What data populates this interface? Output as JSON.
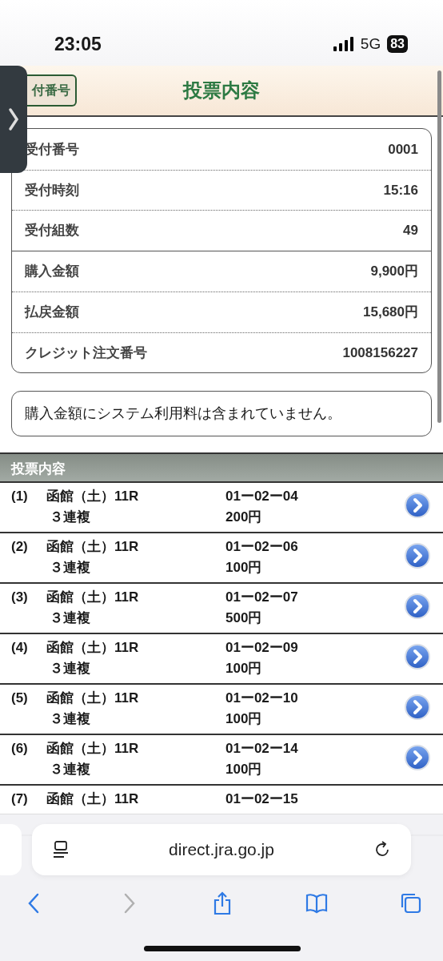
{
  "status_bar": {
    "time": "23:05",
    "network": "5G",
    "battery": "83"
  },
  "header": {
    "back_button": "付番号",
    "title": "投票内容"
  },
  "summary": {
    "groups": [
      [
        {
          "label": "受付番号",
          "value": "0001"
        },
        {
          "label": "受付時刻",
          "value": "15:16"
        },
        {
          "label": "受付組数",
          "value": "49"
        }
      ],
      [
        {
          "label": "購入金額",
          "value": "9,900円"
        },
        {
          "label": "払戻金額",
          "value": "15,680円"
        },
        {
          "label": "クレジット注文番号",
          "value": "1008156227"
        }
      ]
    ]
  },
  "note": "購入金額にシステム利用料は含まれていません。",
  "bets": {
    "title": "投票内容",
    "rows": [
      {
        "index": "(1)",
        "race": "函館（土）11R",
        "bet_type": "３連複",
        "numbers": "01ー02ー04",
        "amount": "200円"
      },
      {
        "index": "(2)",
        "race": "函館（土）11R",
        "bet_type": "３連複",
        "numbers": "01ー02ー06",
        "amount": "100円"
      },
      {
        "index": "(3)",
        "race": "函館（土）11R",
        "bet_type": "３連複",
        "numbers": "01ー02ー07",
        "amount": "500円"
      },
      {
        "index": "(4)",
        "race": "函館（土）11R",
        "bet_type": "３連複",
        "numbers": "01ー02ー09",
        "amount": "100円"
      },
      {
        "index": "(5)",
        "race": "函館（土）11R",
        "bet_type": "３連複",
        "numbers": "01ー02ー10",
        "amount": "100円"
      },
      {
        "index": "(6)",
        "race": "函館（土）11R",
        "bet_type": "３連複",
        "numbers": "01ー02ー14",
        "amount": "100円"
      },
      {
        "index": "(7)",
        "race": "函館（土）11R",
        "numbers": "01ー02ー15"
      }
    ]
  },
  "browser": {
    "url": "direct.jra.go.jp",
    "forward_disabled": true
  }
}
